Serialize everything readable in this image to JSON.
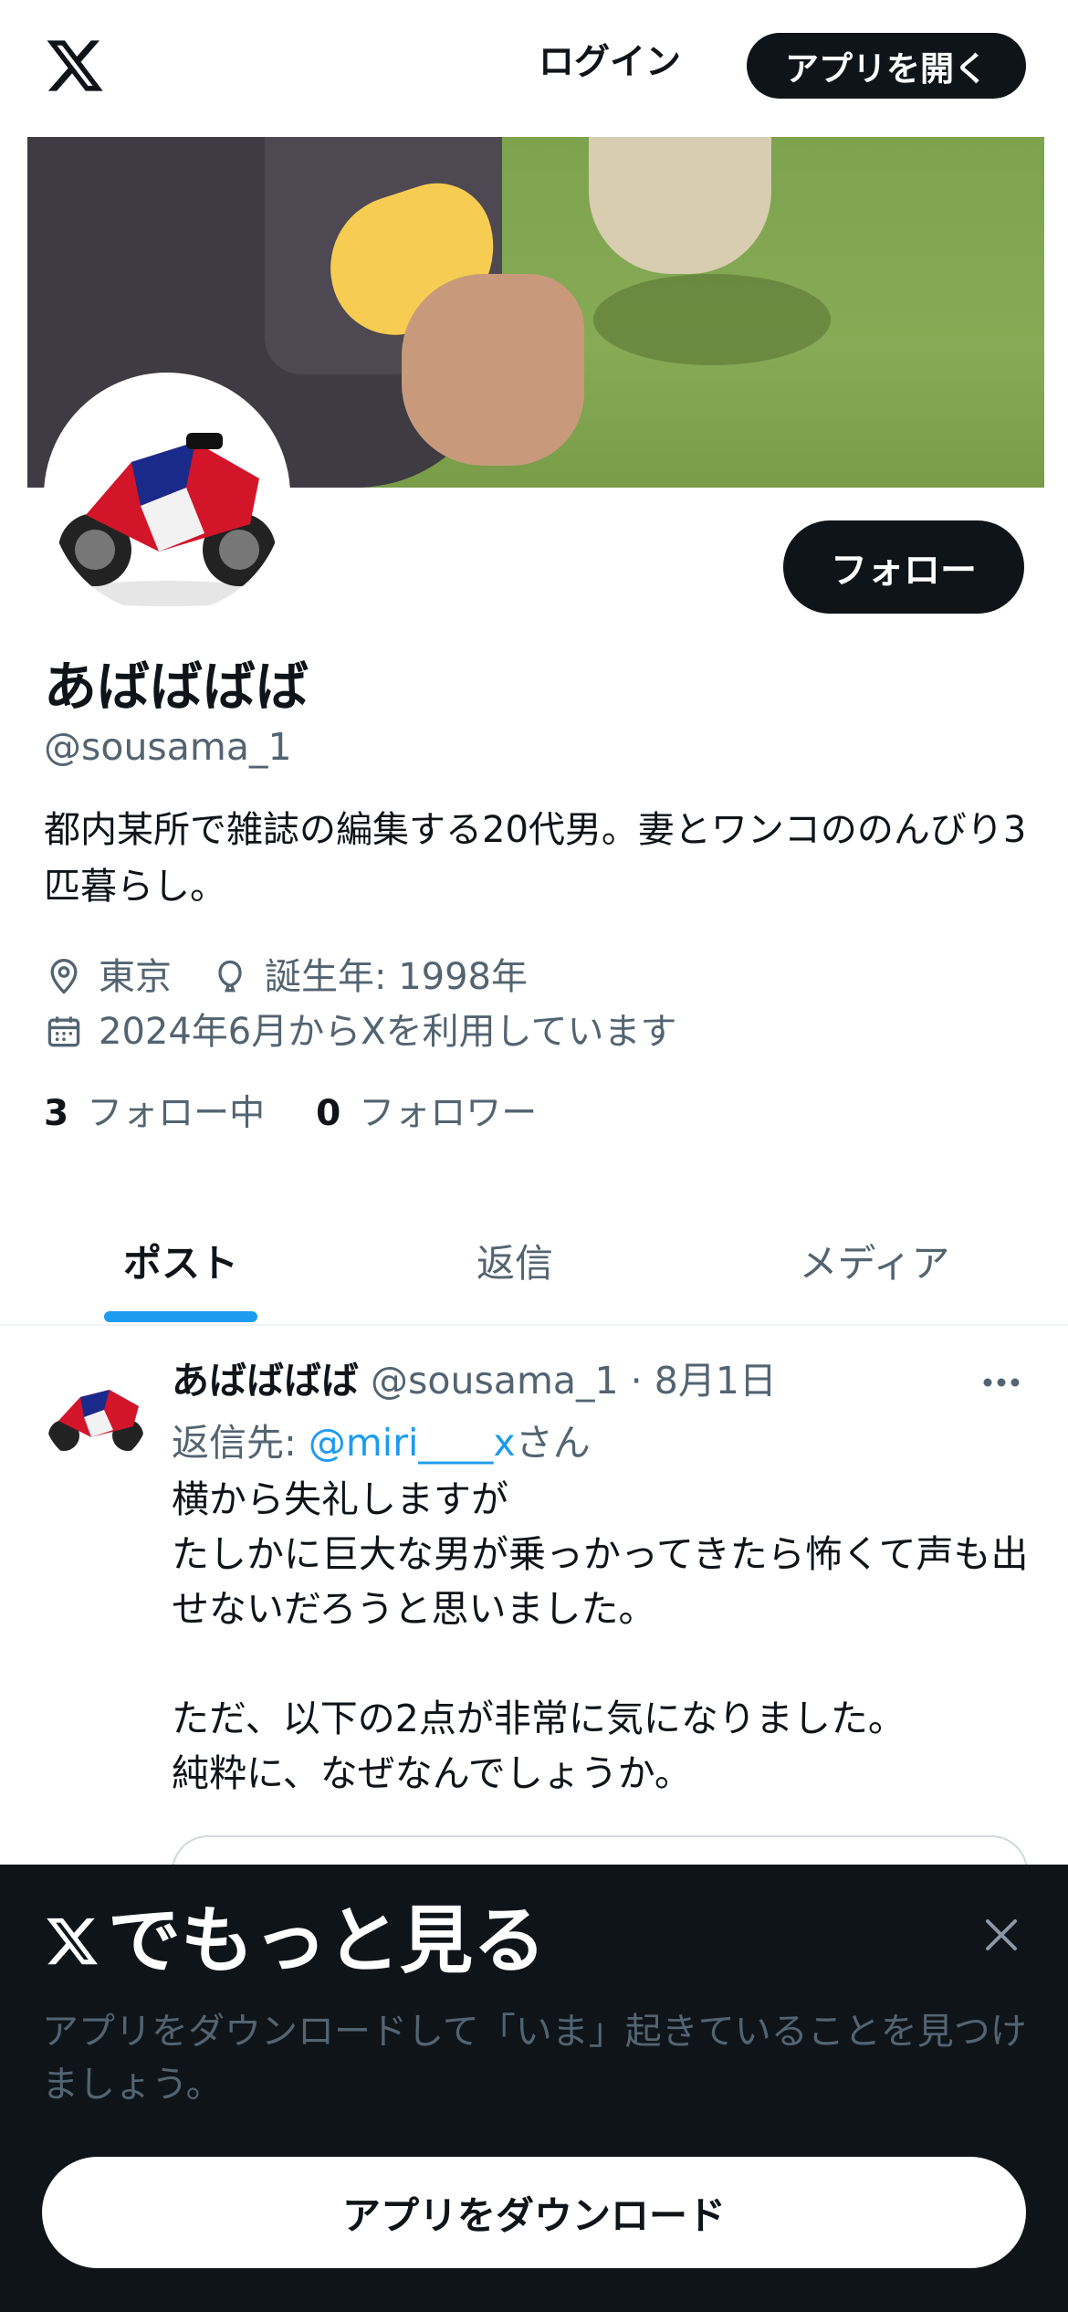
{
  "topbar": {
    "logo": "x-logo",
    "login_label": "ログイン",
    "open_app_label": "アプリを開く"
  },
  "profile": {
    "display_name": "あばばばば",
    "handle": "@sousama_1",
    "bio": "都内某所で雑誌の編集する20代男。妻とワンコののんびり3匹暮らし。",
    "location": "東京",
    "birth": "誕生年: 1998年",
    "joined": "2024年6月からXを利用しています",
    "following_count": "3",
    "following_label": "フォロー中",
    "followers_count": "0",
    "followers_label": "フォロワー",
    "follow_label": "フォロー"
  },
  "tabs": [
    {
      "label": "ポスト",
      "active": true
    },
    {
      "label": "返信",
      "active": false
    },
    {
      "label": "メディア",
      "active": false
    }
  ],
  "post": {
    "author_name": "あばばばば",
    "author_handle": "@sousama_1",
    "separator": "·",
    "date": "8月1日",
    "reply_prefix": "返信先: ",
    "reply_mention": "@miri____x",
    "reply_suffix": "さん",
    "body": "横から失礼しますが\nたしかに巨大な男が乗っかってきたら怖くて声も出せないだろうと思いました。\n\nただ、以下の2点が非常に気になりました。\n純粋に、なぜなんでしょうか。"
  },
  "sheet": {
    "title": "でもっと見る",
    "subtitle": "アプリをダウンロードして「いま」起きていることを見つけましょう。",
    "download_label": "アプリをダウンロード"
  },
  "colors": {
    "accent": "#1d9bf0",
    "text_primary": "#0f1419",
    "text_secondary": "#536471",
    "dark_bg": "#0f1419"
  }
}
